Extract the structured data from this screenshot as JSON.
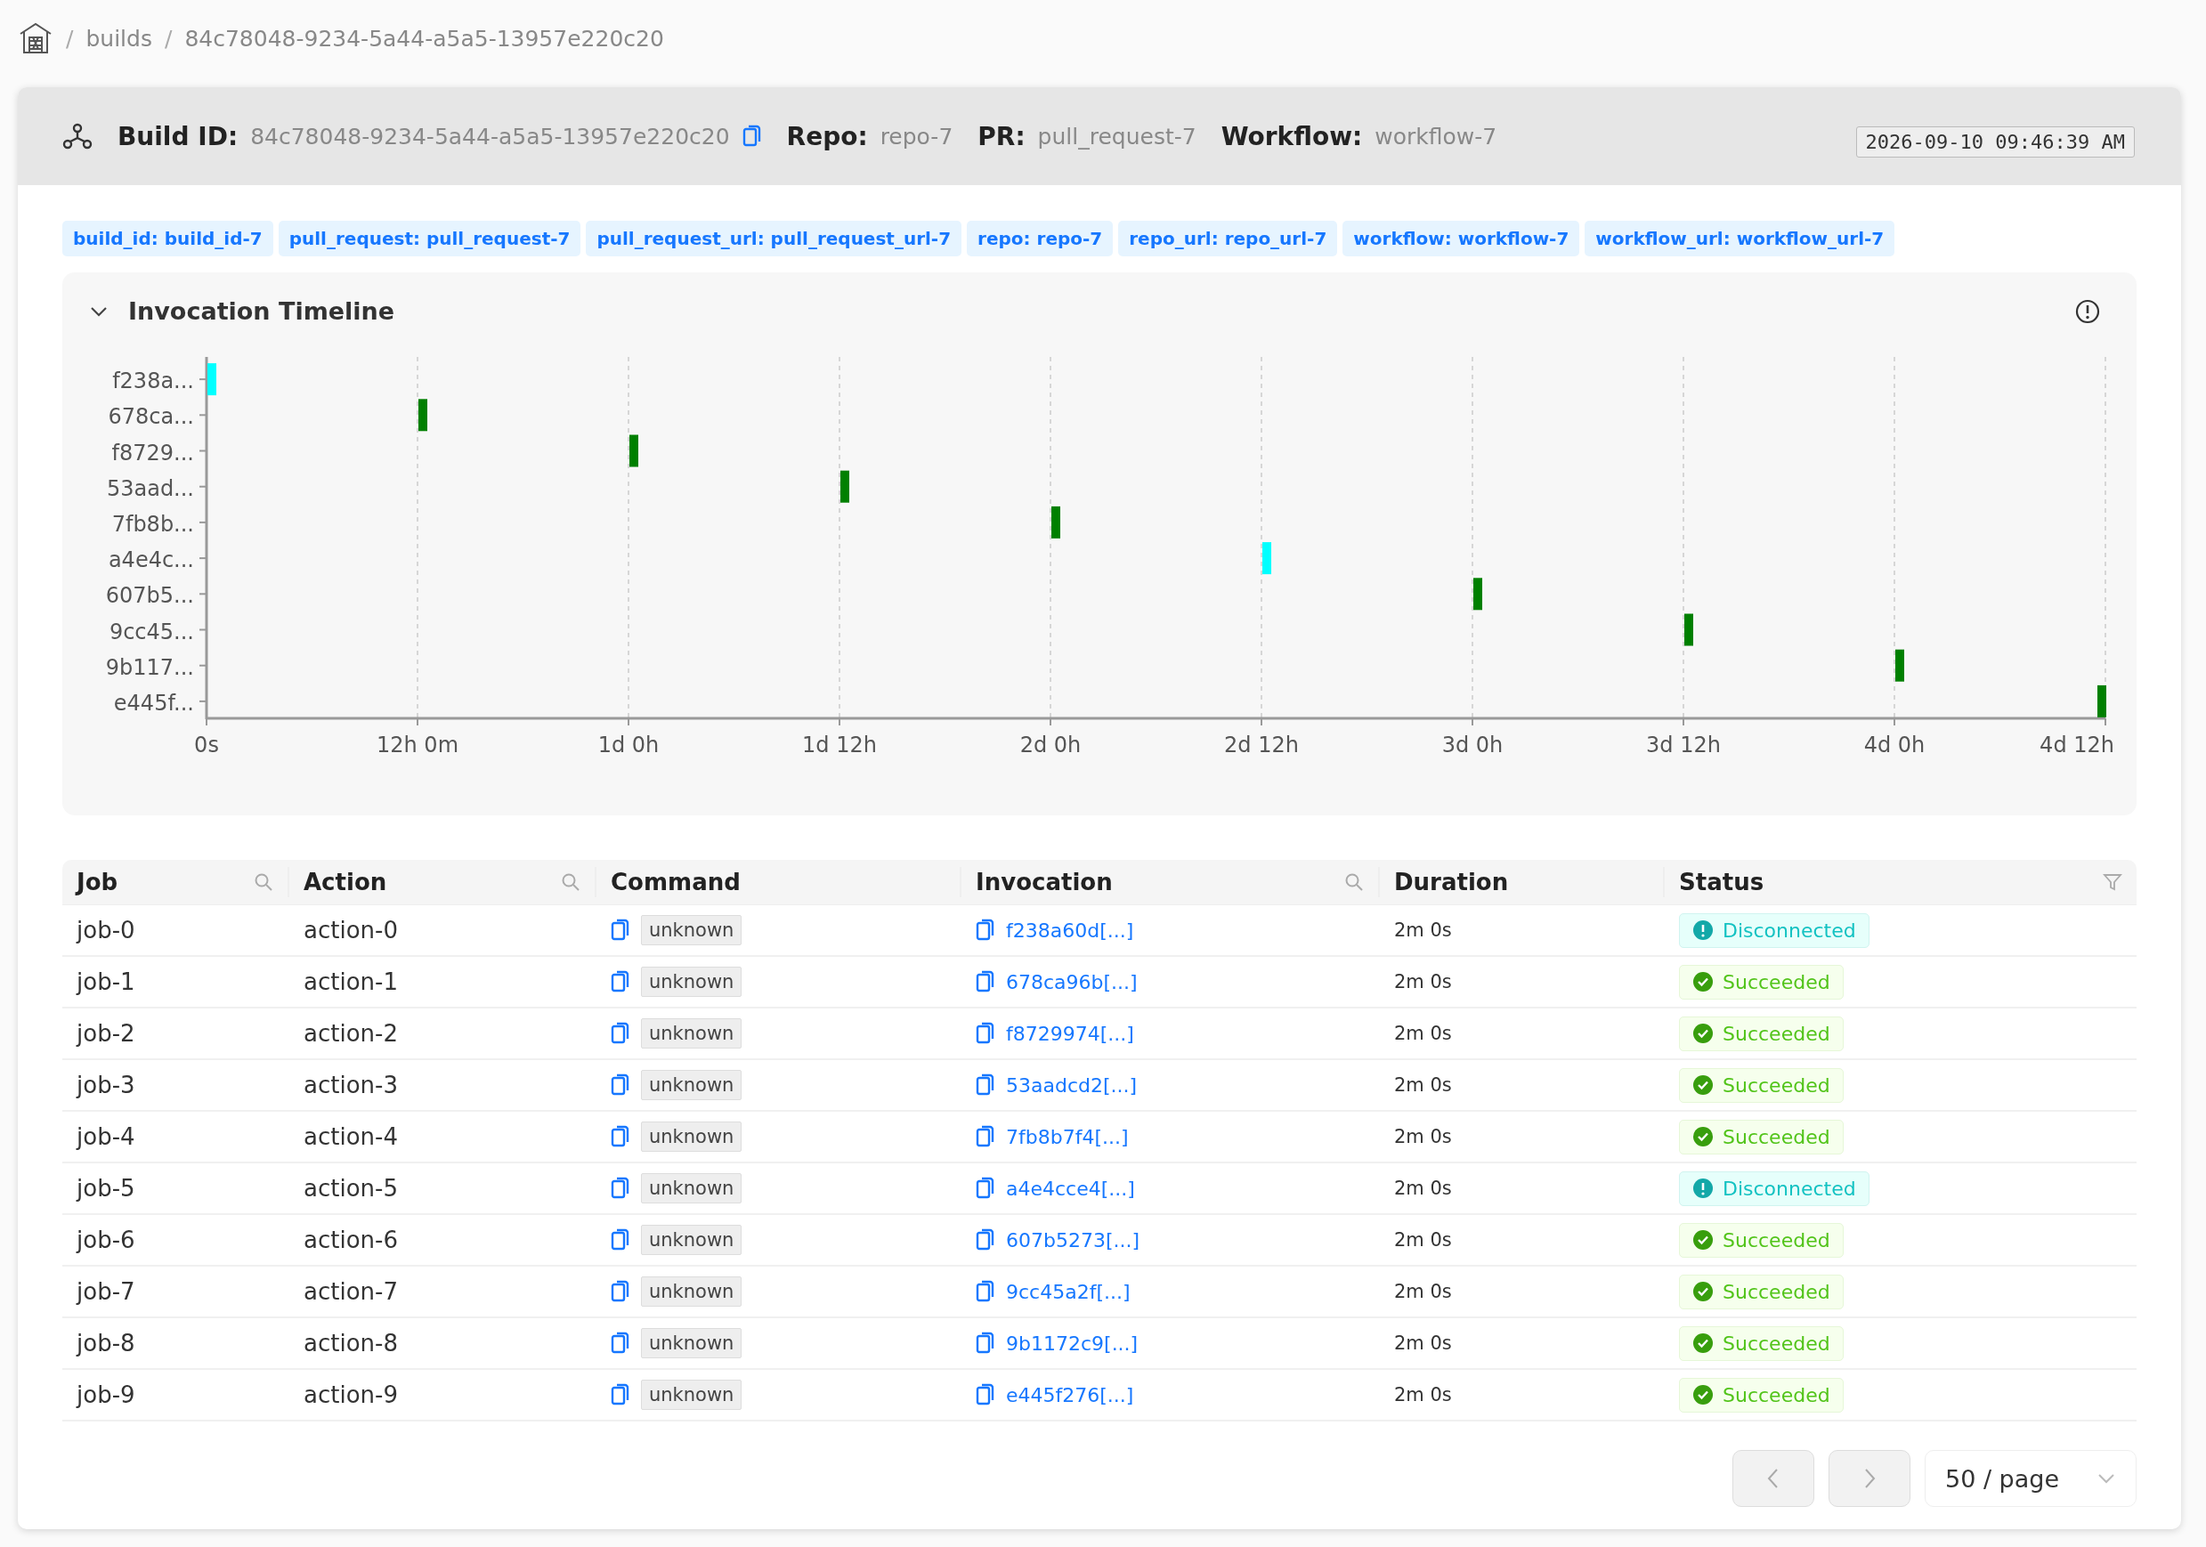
{
  "breadcrumb": {
    "separator": "/",
    "items": [
      "builds",
      "84c78048-9234-5a44-a5a5-13957e220c20"
    ]
  },
  "header": {
    "fields": [
      {
        "label": "Build ID:",
        "value": "84c78048-9234-5a44-a5a5-13957e220c20",
        "copyable": true
      },
      {
        "label": "Repo:",
        "value": "repo-7",
        "copyable": false
      },
      {
        "label": "PR:",
        "value": "pull_request-7",
        "copyable": false
      },
      {
        "label": "Workflow:",
        "value": "workflow-7",
        "copyable": false
      }
    ],
    "timestamp": "2026-09-10 09:46:39 AM"
  },
  "tags": [
    "build_id: build_id-7",
    "pull_request: pull_request-7",
    "pull_request_url: pull_request_url-7",
    "repo: repo-7",
    "repo_url: repo_url-7",
    "workflow: workflow-7",
    "workflow_url: workflow_url-7"
  ],
  "timeline": {
    "title": "Invocation Timeline",
    "expanded": true,
    "entries": [
      {
        "label": "f238a...",
        "tick": "0s",
        "color": "#00ffff"
      },
      {
        "label": "678ca...",
        "tick": "12h 0m",
        "color": "#008000"
      },
      {
        "label": "f8729...",
        "tick": "1d 0h",
        "color": "#008000"
      },
      {
        "label": "53aad...",
        "tick": "1d 12h",
        "color": "#008000"
      },
      {
        "label": "7fb8b...",
        "tick": "2d 0h",
        "color": "#008000"
      },
      {
        "label": "a4e4c...",
        "tick": "2d 12h",
        "color": "#00ffff"
      },
      {
        "label": "607b5...",
        "tick": "3d 0h",
        "color": "#008000"
      },
      {
        "label": "9cc45...",
        "tick": "3d 12h",
        "color": "#008000"
      },
      {
        "label": "9b117...",
        "tick": "4d 0h",
        "color": "#008000"
      },
      {
        "label": "e445f...",
        "tick": "4d 12h",
        "color": "#008000"
      }
    ]
  },
  "table": {
    "columns": [
      {
        "label": "Job",
        "searchable": true,
        "filterable": false
      },
      {
        "label": "Action",
        "searchable": true,
        "filterable": false
      },
      {
        "label": "Command",
        "searchable": false,
        "filterable": false
      },
      {
        "label": "Invocation",
        "searchable": true,
        "filterable": false
      },
      {
        "label": "Duration",
        "searchable": false,
        "filterable": false
      },
      {
        "label": "Status",
        "searchable": false,
        "filterable": true
      }
    ],
    "rows": [
      {
        "job": "job-0",
        "action": "action-0",
        "command": "unknown",
        "invocation": "f238a60d[...]",
        "duration": "2m 0s",
        "status": {
          "kind": "disconnected",
          "label": "Disconnected"
        }
      },
      {
        "job": "job-1",
        "action": "action-1",
        "command": "unknown",
        "invocation": "678ca96b[...]",
        "duration": "2m 0s",
        "status": {
          "kind": "succeeded",
          "label": "Succeeded"
        }
      },
      {
        "job": "job-2",
        "action": "action-2",
        "command": "unknown",
        "invocation": "f8729974[...]",
        "duration": "2m 0s",
        "status": {
          "kind": "succeeded",
          "label": "Succeeded"
        }
      },
      {
        "job": "job-3",
        "action": "action-3",
        "command": "unknown",
        "invocation": "53aadcd2[...]",
        "duration": "2m 0s",
        "status": {
          "kind": "succeeded",
          "label": "Succeeded"
        }
      },
      {
        "job": "job-4",
        "action": "action-4",
        "command": "unknown",
        "invocation": "7fb8b7f4[...]",
        "duration": "2m 0s",
        "status": {
          "kind": "succeeded",
          "label": "Succeeded"
        }
      },
      {
        "job": "job-5",
        "action": "action-5",
        "command": "unknown",
        "invocation": "a4e4cce4[...]",
        "duration": "2m 0s",
        "status": {
          "kind": "disconnected",
          "label": "Disconnected"
        }
      },
      {
        "job": "job-6",
        "action": "action-6",
        "command": "unknown",
        "invocation": "607b5273[...]",
        "duration": "2m 0s",
        "status": {
          "kind": "succeeded",
          "label": "Succeeded"
        }
      },
      {
        "job": "job-7",
        "action": "action-7",
        "command": "unknown",
        "invocation": "9cc45a2f[...]",
        "duration": "2m 0s",
        "status": {
          "kind": "succeeded",
          "label": "Succeeded"
        }
      },
      {
        "job": "job-8",
        "action": "action-8",
        "command": "unknown",
        "invocation": "9b1172c9[...]",
        "duration": "2m 0s",
        "status": {
          "kind": "succeeded",
          "label": "Succeeded"
        }
      },
      {
        "job": "job-9",
        "action": "action-9",
        "command": "unknown",
        "invocation": "e445f276[...]",
        "duration": "2m 0s",
        "status": {
          "kind": "succeeded",
          "label": "Succeeded"
        }
      }
    ]
  },
  "pagination": {
    "page_size": "50 / page",
    "prev_disabled": true,
    "next_disabled": true
  }
}
